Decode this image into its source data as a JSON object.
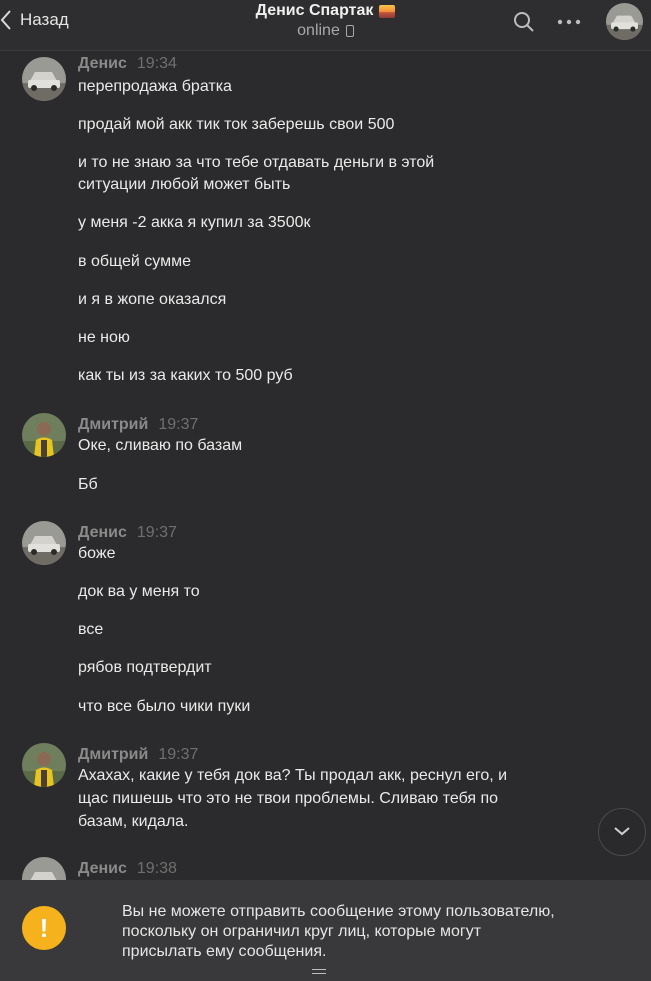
{
  "header": {
    "back_label": "Назад",
    "title": "Денис Спартак",
    "status": "online"
  },
  "messages": [
    {
      "author": "Денис",
      "time": "19:34",
      "avatar": "car-photo",
      "lines": [
        "перепродажа братка",
        "продай мой акк тик ток заберешь свои 500",
        "и то не знаю за что тебе отдавать деньги в этой",
        "ситуации любой может быть",
        "у меня -2 акка я купил за 3500к",
        "в общей сумме",
        "и я в жопе оказался",
        "не ною",
        "как ты из за каких то 500 руб"
      ]
    },
    {
      "author": "Дмитрий",
      "time": "19:37",
      "avatar": "person-photo",
      "lines": [
        "Оке, сливаю по базам",
        "Бб"
      ]
    },
    {
      "author": "Денис",
      "time": "19:37",
      "avatar": "car-photo",
      "lines": [
        "боже",
        "док ва у меня то",
        "все",
        "рябов подтвердит",
        "что все было чики пуки"
      ]
    },
    {
      "author": "Дмитрий",
      "time": "19:37",
      "avatar": "person-photo",
      "lines": [
        "Ахахах, какие у тебя док ва? Ты продал акк, реснул его, и",
        "щас пишешь что это не твои проблемы. Сливаю тебя по",
        "базам, кидала."
      ]
    },
    {
      "author": "Денис",
      "time": "19:38",
      "avatar": "car-photo",
      "lines": []
    }
  ],
  "banner": {
    "icon": "exclamation-icon",
    "lines": [
      "Вы не можете отправить сообщение этому пользователю,",
      "поскольку он ограничил круг лиц, которые могут",
      "присылать ему сообщения."
    ]
  },
  "colors": {
    "background": "#2b2b2d",
    "banner": "#39393b",
    "warning": "#f5b21c",
    "author": "#8a8a8a"
  }
}
